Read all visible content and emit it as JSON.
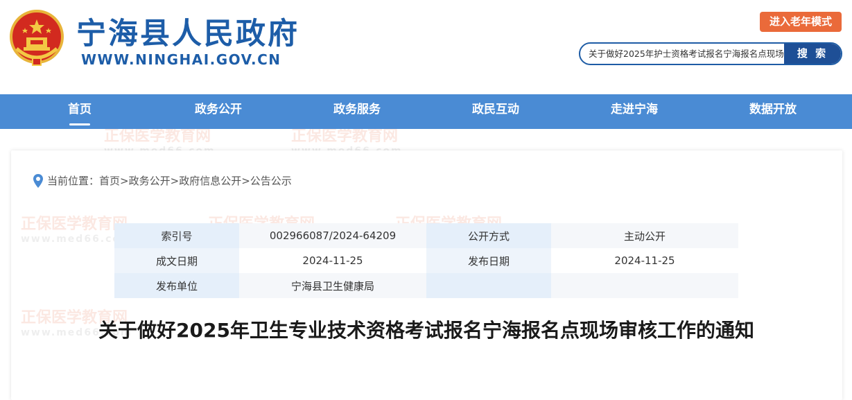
{
  "header": {
    "site_title": "宁海县人民政府",
    "site_url": "WWW.NINGHAI.GOV.CN",
    "elder_mode_label": "进入老年模式",
    "search": {
      "value": "关于做好2025年护士资格考试报名宁海报名点现场",
      "button_label": "搜 索"
    }
  },
  "nav": {
    "items": [
      {
        "label": "首页",
        "active": true
      },
      {
        "label": "政务公开"
      },
      {
        "label": "政务服务"
      },
      {
        "label": "政民互动"
      },
      {
        "label": "走进宁海"
      },
      {
        "label": "数据开放"
      }
    ]
  },
  "breadcrumb": {
    "prefix": "当前位置：",
    "items": [
      "首页",
      "政务公开",
      "政府信息公开",
      "公告公示"
    ],
    "separator": ">"
  },
  "info": {
    "index_label": "索引号",
    "index_value": "002966087/2024-64209",
    "open_mode_label": "公开方式",
    "open_mode_value": "主动公开",
    "created_label": "成文日期",
    "created_value": "2024-11-25",
    "published_label": "发布日期",
    "published_value": "2024-11-25",
    "publisher_label": "发布单位",
    "publisher_value": "宁海县卫生健康局"
  },
  "article": {
    "title": "关于做好2025年卫生专业技术资格考试报名宁海报名点现场审核工作的通知"
  },
  "watermark": {
    "cn": "正保医学教育网",
    "en": "www.med66.com"
  },
  "colors": {
    "brand_blue": "#1d5da8",
    "nav_blue": "#4a8bd4",
    "elder_orange": "#ea6a3a",
    "search_button": "#1e4f96"
  }
}
